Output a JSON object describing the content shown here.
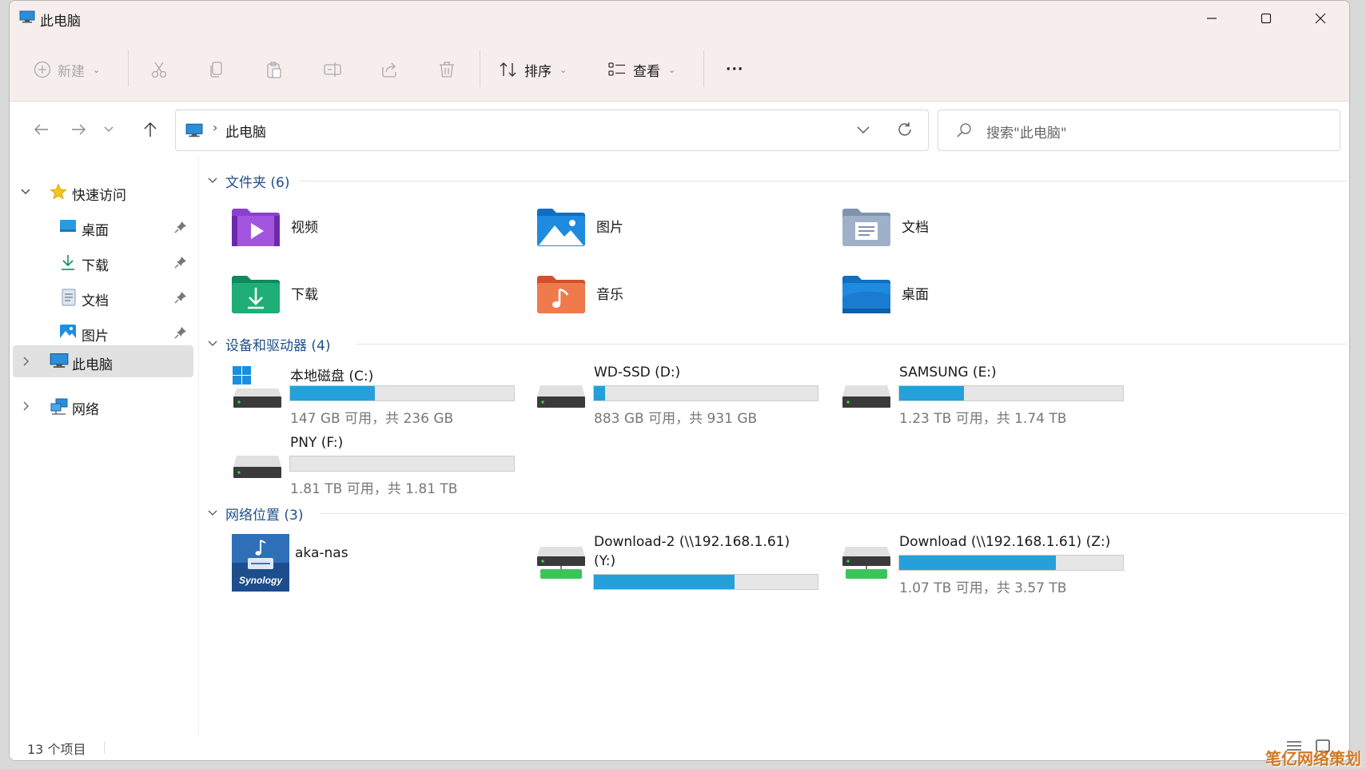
{
  "window": {
    "title": "此电脑"
  },
  "toolbar": {
    "new_label": "新建",
    "sort_label": "排序",
    "view_label": "查看",
    "more_label": "···"
  },
  "nav": {
    "address_text": "此电脑",
    "search_placeholder": "搜索\"此电脑\""
  },
  "sidebar": {
    "quick_access": "快速访问",
    "items": [
      {
        "label": "桌面"
      },
      {
        "label": "下载"
      },
      {
        "label": "文档"
      },
      {
        "label": "图片"
      }
    ],
    "this_pc": "此电脑",
    "network": "网络"
  },
  "groups": {
    "folders_title": "文件夹 (6)",
    "drives_title": "设备和驱动器 (4)",
    "network_title": "网络位置 (3)"
  },
  "folders": [
    {
      "name": "视频",
      "icon": "videos-folder-icon"
    },
    {
      "name": "图片",
      "icon": "pictures-folder-icon"
    },
    {
      "name": "文档",
      "icon": "documents-folder-icon"
    },
    {
      "name": "下载",
      "icon": "downloads-folder-icon"
    },
    {
      "name": "音乐",
      "icon": "music-folder-icon"
    },
    {
      "name": "桌面",
      "icon": "desktop-folder-icon"
    }
  ],
  "drives": [
    {
      "name": "本地磁盘 (C:)",
      "info": "147 GB 可用，共 236 GB",
      "used_fraction": 0.38
    },
    {
      "name": "WD-SSD (D:)",
      "info": "883 GB 可用，共 931 GB",
      "used_fraction": 0.05
    },
    {
      "name": "SAMSUNG (E:)",
      "info": "1.23 TB 可用，共 1.74 TB",
      "used_fraction": 0.29
    },
    {
      "name": "PNY (F:)",
      "info": "1.81 TB 可用，共 1.81 TB",
      "used_fraction": 0.0
    }
  ],
  "network_locations": [
    {
      "name": "aka-nas",
      "logo_text": "Synology"
    },
    {
      "name_line1": "Download-2 (\\\\192.168.1.61)",
      "name_line2": "(Y:)",
      "used_fraction": 0.63
    },
    {
      "name": "Download (\\\\192.168.1.61) (Z:)",
      "info": "1.07 TB 可用，共 3.57 TB",
      "used_fraction": 0.7
    }
  ],
  "status": {
    "count": "13 个项目"
  },
  "watermark": "笔亿网络策划",
  "colors": {
    "accent": "#26a0da",
    "group_header": "#1f4f8a",
    "titlebar_bg": "#f6eeec"
  }
}
